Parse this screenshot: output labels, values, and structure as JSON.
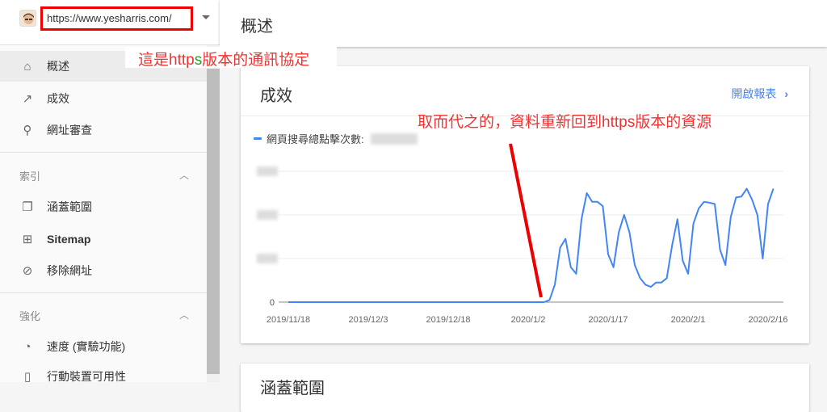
{
  "header": {
    "site_url": "https://www.yesharris.com/",
    "page_title": "概述"
  },
  "sidebar": {
    "items": [
      {
        "label": "概述",
        "icon": "home-icon"
      },
      {
        "label": "成效",
        "icon": "trending-up-icon"
      },
      {
        "label": "網址審查",
        "icon": "search-icon"
      }
    ],
    "sections": [
      {
        "title": "索引",
        "items": [
          {
            "label": "涵蓋範圍",
            "icon": "copy-icon"
          },
          {
            "label": "Sitemap",
            "icon": "sitemap-icon"
          },
          {
            "label": "移除網址",
            "icon": "eye-off-icon"
          }
        ]
      },
      {
        "title": "強化",
        "items": [
          {
            "label": "速度 (實驗功能)",
            "icon": "speed-icon"
          },
          {
            "label": "行動裝置可用性",
            "icon": "phone-icon"
          }
        ]
      }
    ]
  },
  "annotations": {
    "a1_pre": "這是http",
    "a1_s": "s",
    "a1_post": "版本的通訊協定",
    "a2": "取而代之的，資料重新回到https版本的資源"
  },
  "card": {
    "title": "成效",
    "open_report": "開啟報表",
    "next_title": "涵蓋範圍"
  },
  "chart_data": {
    "type": "line",
    "legend": "網頁搜尋總點擊次數:",
    "series_color": "#4285f4",
    "x_start": "2019/11/18",
    "x_ticks": [
      {
        "day": 0,
        "label": "2019/11/18"
      },
      {
        "day": 15,
        "label": "2019/12/3"
      },
      {
        "day": 30,
        "label": "2019/12/18"
      },
      {
        "day": 45,
        "label": "2020/1/2"
      },
      {
        "day": 60,
        "label": "2020/1/17"
      },
      {
        "day": 75,
        "label": "2020/2/1"
      },
      {
        "day": 90,
        "label": "2020/2/16"
      }
    ],
    "y_ticks": [
      {
        "value": 0,
        "label": "0"
      },
      {
        "value": 1,
        "label": ""
      },
      {
        "value": 2,
        "label": ""
      },
      {
        "value": 3,
        "label": ""
      }
    ],
    "ylim": [
      0,
      3
    ],
    "values": [
      0,
      0,
      0,
      0,
      0,
      0,
      0,
      0,
      0,
      0,
      0,
      0,
      0,
      0,
      0,
      0,
      0,
      0,
      0,
      0,
      0,
      0,
      0,
      0,
      0,
      0,
      0,
      0,
      0,
      0,
      0,
      0,
      0,
      0,
      0,
      0,
      0,
      0,
      0,
      0,
      0,
      0,
      0,
      0,
      0,
      0,
      0,
      0,
      0,
      0.05,
      0.4,
      1.25,
      1.45,
      0.8,
      0.65,
      1.9,
      2.5,
      2.3,
      2.3,
      2.2,
      1.1,
      0.8,
      1.6,
      2.0,
      1.6,
      0.85,
      0.55,
      0.4,
      0.35,
      0.45,
      0.45,
      0.55,
      1.3,
      1.9,
      0.95,
      0.65,
      1.8,
      2.15,
      2.3,
      2.28,
      2.25,
      1.2,
      0.85,
      1.95,
      2.4,
      2.42,
      2.6,
      2.35,
      2.0,
      1.0,
      2.25,
      2.6
    ]
  }
}
